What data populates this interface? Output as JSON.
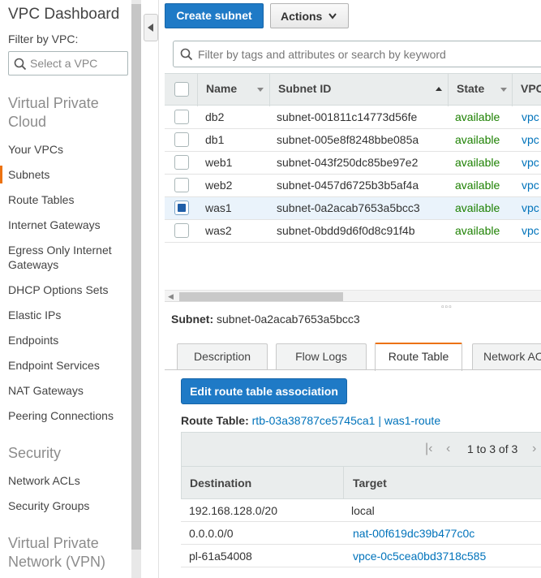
{
  "sidebar": {
    "title": "VPC Dashboard",
    "filter_label": "Filter by VPC:",
    "vpc_placeholder": "Select a VPC",
    "section_vpc": "Virtual Private Cloud",
    "items_vpc": [
      "Your VPCs",
      "Subnets",
      "Route Tables",
      "Internet Gateways",
      "Egress Only Internet Gateways",
      "DHCP Options Sets",
      "Elastic IPs",
      "Endpoints",
      "Endpoint Services",
      "NAT Gateways",
      "Peering Connections"
    ],
    "active_item": "Subnets",
    "section_security": "Security",
    "items_security": [
      "Network ACLs",
      "Security Groups"
    ],
    "section_vpn": "Virtual Private Network (VPN)"
  },
  "toolbar": {
    "create_label": "Create subnet",
    "actions_label": "Actions"
  },
  "search": {
    "placeholder": "Filter by tags and attributes or search by keyword"
  },
  "subnet_table": {
    "columns": [
      "Name",
      "Subnet ID",
      "State",
      "VPC"
    ],
    "rows": [
      {
        "name": "db2",
        "subnet_id": "subnet-001811c14773d56fe",
        "state": "available",
        "vpc": "vpc",
        "selected": false
      },
      {
        "name": "db1",
        "subnet_id": "subnet-005e8f8248bbe085a",
        "state": "available",
        "vpc": "vpc",
        "selected": false
      },
      {
        "name": "web1",
        "subnet_id": "subnet-043f250dc85be97e2",
        "state": "available",
        "vpc": "vpc",
        "selected": false
      },
      {
        "name": "web2",
        "subnet_id": "subnet-0457d6725b3b5af4a",
        "state": "available",
        "vpc": "vpc",
        "selected": false
      },
      {
        "name": "was1",
        "subnet_id": "subnet-0a2acab7653a5bcc3",
        "state": "available",
        "vpc": "vpc",
        "selected": true
      },
      {
        "name": "was2",
        "subnet_id": "subnet-0bdd9d6f0d8c91f4b",
        "state": "available",
        "vpc": "vpc",
        "selected": false
      }
    ]
  },
  "detail": {
    "subnet_key": "Subnet:",
    "subnet_value": "subnet-0a2acab7653a5bcc3",
    "tabs": [
      "Description",
      "Flow Logs",
      "Route Table",
      "Network ACL"
    ],
    "active_tab": "Route Table",
    "edit_button": "Edit route table association",
    "route_table_key": "Route Table:",
    "route_table_value": "rtb-03a38787ce5745ca1 | was1-route",
    "pager_text": "1 to 3 of 3",
    "routes_columns": [
      "Destination",
      "Target"
    ],
    "routes": [
      {
        "destination": "192.168.128.0/20",
        "target": "local",
        "target_link": false
      },
      {
        "destination": "0.0.0.0/0",
        "target": "nat-00f619dc39b477c0c",
        "target_link": true
      },
      {
        "destination": "pl-61a54008",
        "target": "vpce-0c5cea0bd3718c585",
        "target_link": true
      }
    ]
  },
  "colors": {
    "primary_button": "#1f7ac6",
    "active_accent": "#ec7211",
    "state_green": "#1d8102",
    "link_blue": "#0073bb"
  }
}
